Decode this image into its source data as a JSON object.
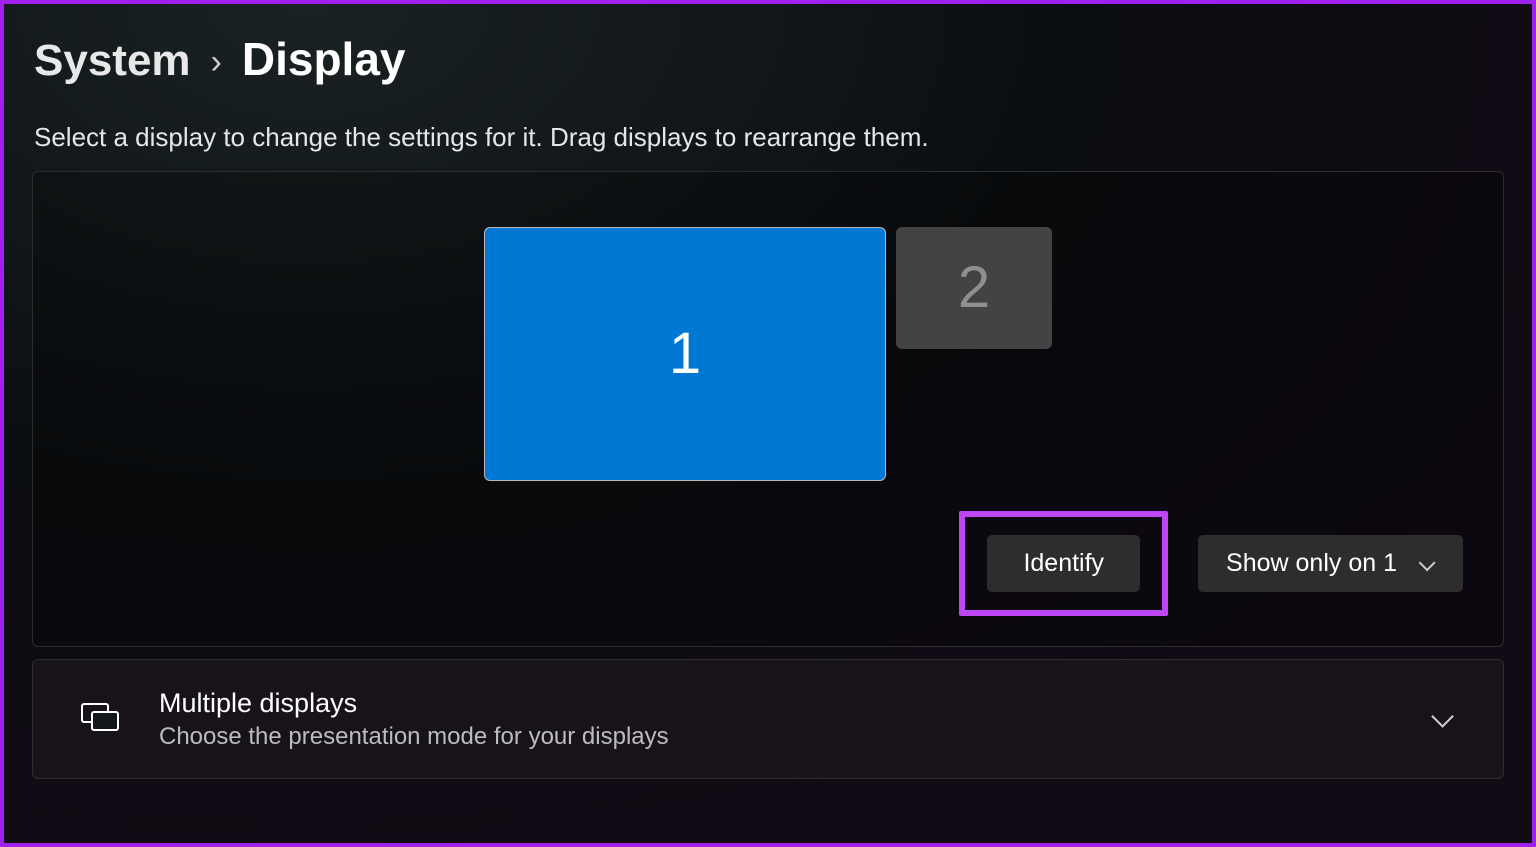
{
  "breadcrumb": {
    "parent": "System",
    "separator": "›",
    "current": "Display"
  },
  "instruction": "Select a display to change the settings for it. Drag displays to rearrange them.",
  "monitors": {
    "primary_label": "1",
    "secondary_label": "2"
  },
  "buttons": {
    "identify": "Identify",
    "projection_selected": "Show only on 1"
  },
  "multiple_displays": {
    "title": "Multiple displays",
    "subtitle": "Choose the presentation mode for your displays"
  },
  "colors": {
    "accent_primary": "#0078d4",
    "highlight": "#bf46f5"
  }
}
